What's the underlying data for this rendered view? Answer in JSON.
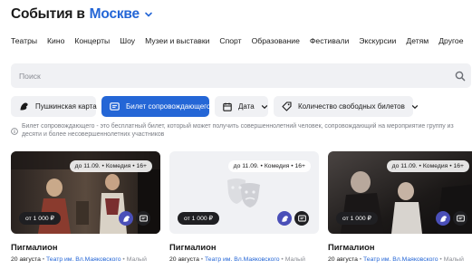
{
  "header": {
    "title": "События в",
    "city": "Москве"
  },
  "categories": [
    "Театры",
    "Кино",
    "Концерты",
    "Шоу",
    "Музеи и выставки",
    "Спорт",
    "Образование",
    "Фестивали",
    "Экскурсии",
    "Детям",
    "Другое"
  ],
  "search": {
    "placeholder": "Поиск"
  },
  "filters": {
    "pushkin_card": "Пушкинская карта",
    "companion_ticket": "Билет сопровождающего",
    "date": "Дата",
    "free_tickets": "Количество свободных билетов"
  },
  "note": "Билет сопровождающего - это бесплатный билет, который может получить совершеннолетний человек, сопровождающий на мероприятие группу из десяти и более несовершеннолетних участников",
  "cards": [
    {
      "badge": "до 11.09. • Комедия • 16+",
      "price": "от 1 000 ₽",
      "name": "Пигмалион",
      "date": "20 августа",
      "sep": " • ",
      "venue": "Театр им. Вл.Маяковского",
      "sep2": " • ",
      "hall": "Малый",
      "extra": ""
    },
    {
      "badge": "до 11.09. • Комедия • 16+",
      "price": "от 1 000 ₽",
      "name": "Пигмалион",
      "date": "20 августа",
      "sep": " • ",
      "venue": "Театр им. Вл.Маяковского",
      "sep2": " • ",
      "hall": "Малый",
      "extra": ""
    },
    {
      "badge": "до 11.09. • Комедия • 16+",
      "price": "от 1 000 ₽",
      "name": "Пигмалион",
      "date": "20 августа",
      "sep": " • ",
      "venue": "Театр им. Вл.Маяковского",
      "sep2": " • ",
      "hall": "Малый",
      "extra": ""
    }
  ],
  "colors": {
    "accent": "#2466d6",
    "chip_bg": "#f0f1f4",
    "dark": "#1f1f22",
    "pushkin": "#4a4fb8"
  },
  "icons": {
    "city_dropdown": "chevron-down-icon",
    "search": "search-icon",
    "pushkin": "pushkin-card-icon",
    "ticket": "ticket-icon",
    "calendar": "calendar-icon",
    "tag": "tag-icon",
    "info": "info-icon",
    "theatre": "theatre-mask-icon"
  }
}
